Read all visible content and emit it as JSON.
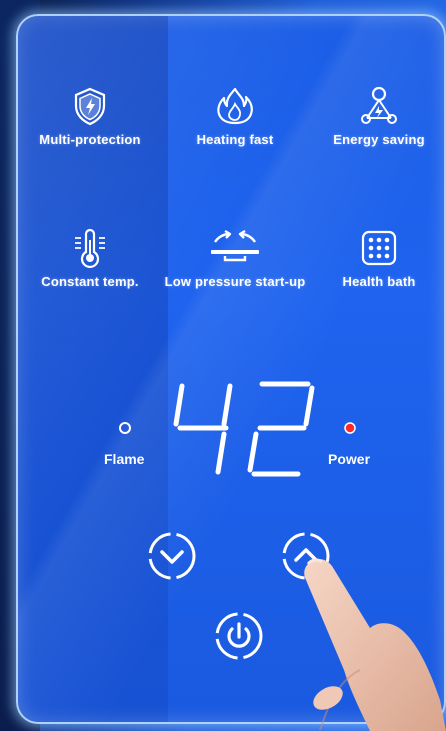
{
  "features": [
    {
      "label": "Multi-protection",
      "icon": "shield-bolt-icon"
    },
    {
      "label": "Heating fast",
      "icon": "flame-icon"
    },
    {
      "label": "Energy saving",
      "icon": "energy-network-icon"
    },
    {
      "label": "Constant temp.",
      "icon": "thermometer-icon"
    },
    {
      "label": "Low pressure start-up",
      "icon": "pressure-arrows-icon"
    },
    {
      "label": "Health bath",
      "icon": "water-dots-icon"
    }
  ],
  "display": {
    "temperature": "42",
    "flame_label": "Flame",
    "power_label": "Power",
    "flame_indicator_on": false,
    "power_indicator_on": true
  },
  "controls": {
    "down": "chevron-down-icon",
    "up": "chevron-up-icon",
    "power": "power-icon"
  },
  "colors": {
    "panel": "#1f63ee",
    "power_led": "#ff2a2a",
    "icon": "#ffffff"
  }
}
